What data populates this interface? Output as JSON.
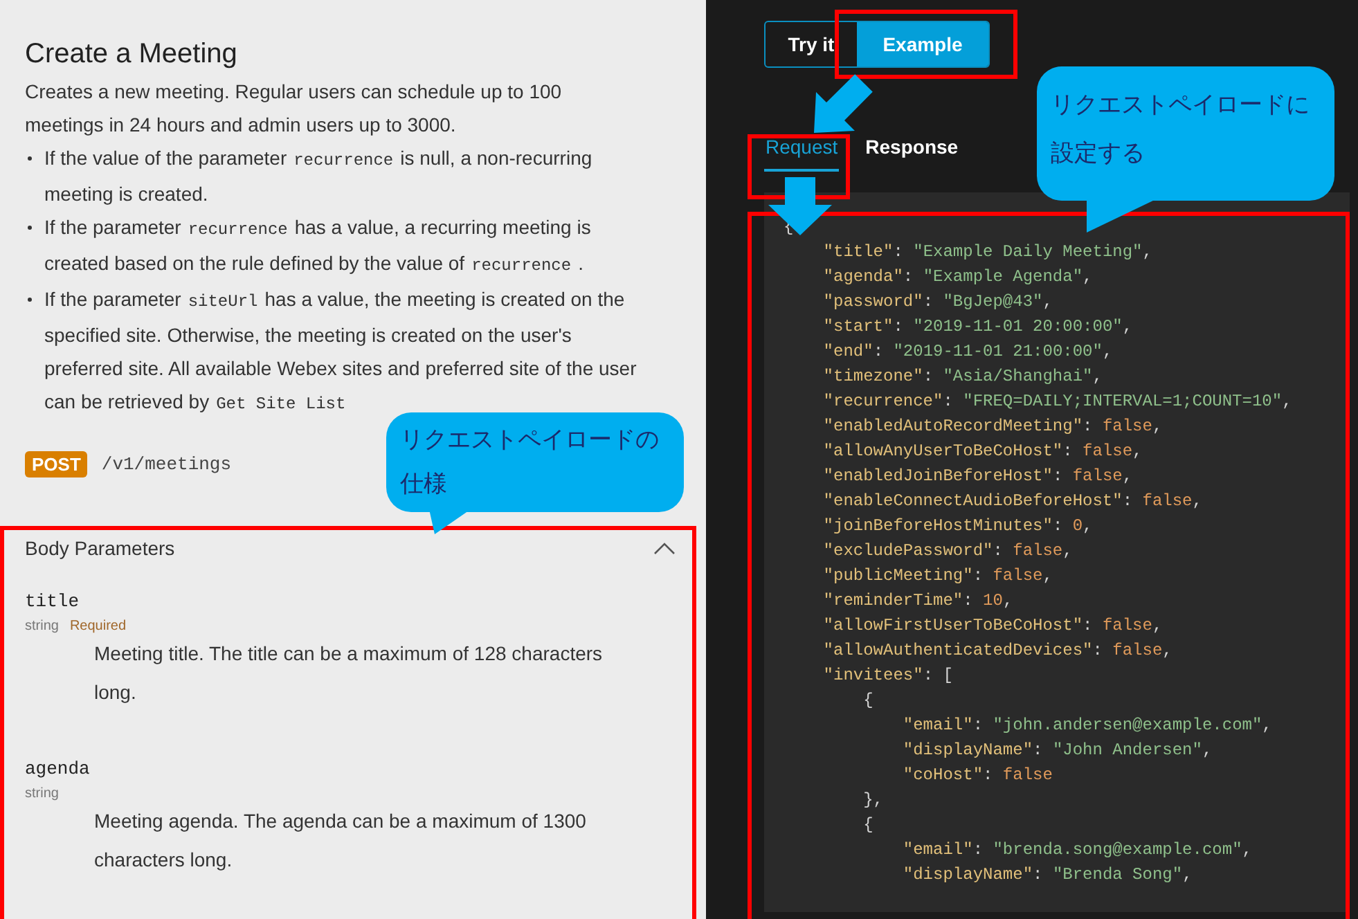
{
  "doc": {
    "title": "Create a Meeting",
    "description": "Creates a new meeting. Regular users can schedule up to 100 meetings in 24 hours and admin users up to 3000.",
    "bullets": [
      [
        {
          "kind": "text",
          "text": "If the value of the parameter"
        },
        {
          "kind": "code",
          "text": "recurrence"
        },
        {
          "kind": "text",
          "text": "is null, a non-recurring meeting is created."
        }
      ],
      [
        {
          "kind": "text",
          "text": "If the parameter"
        },
        {
          "kind": "code",
          "text": "recurrence"
        },
        {
          "kind": "text",
          "text": "has a value, a recurring meeting is created based on the rule defined by the value of"
        },
        {
          "kind": "code",
          "text": "recurrence"
        },
        {
          "kind": "text",
          "text": "."
        }
      ],
      [
        {
          "kind": "text",
          "text": "If the parameter"
        },
        {
          "kind": "code",
          "text": "siteUrl"
        },
        {
          "kind": "text",
          "text": "has a value, the meeting is created on the specified site. Otherwise, the meeting is created on the user's preferred site. All available Webex sites and preferred site of the user can be retrieved by"
        },
        {
          "kind": "code",
          "text": "Get Site List"
        }
      ]
    ],
    "endpoint": {
      "method": "POST",
      "path": "/v1/meetings"
    },
    "body_parameters": {
      "title": "Body Parameters",
      "expanded": true,
      "params": [
        {
          "name": "title",
          "type": "string",
          "required_label": "Required",
          "description": "Meeting title. The title can be a maximum of 128 characters long."
        },
        {
          "name": "agenda",
          "type": "string",
          "description": "Meeting agenda. The agenda can be a maximum of 1300 characters long."
        }
      ]
    }
  },
  "example": {
    "mode_buttons": [
      {
        "label": "Try it",
        "selected": false
      },
      {
        "label": "Example",
        "selected": true
      }
    ],
    "tabs": [
      {
        "label": "Request",
        "selected": true
      },
      {
        "label": "Response",
        "selected": false
      }
    ],
    "code_lines": [
      {
        "tokens": [
          {
            "kind": "punct",
            "text": "{"
          }
        ],
        "children": [
          {
            "tokens": [
              {
                "kind": "key",
                "text": "\"title\""
              },
              {
                "kind": "punct",
                "text": ": "
              },
              {
                "kind": "string",
                "text": "\"Example Daily Meeting\""
              },
              {
                "kind": "punct",
                "text": ","
              }
            ]
          },
          {
            "tokens": [
              {
                "kind": "key",
                "text": "\"agenda\""
              },
              {
                "kind": "punct",
                "text": ": "
              },
              {
                "kind": "string",
                "text": "\"Example Agenda\""
              },
              {
                "kind": "punct",
                "text": ","
              }
            ]
          },
          {
            "tokens": [
              {
                "kind": "key",
                "text": "\"password\""
              },
              {
                "kind": "punct",
                "text": ": "
              },
              {
                "kind": "string",
                "text": "\"BgJep@43\""
              },
              {
                "kind": "punct",
                "text": ","
              }
            ]
          },
          {
            "tokens": [
              {
                "kind": "key",
                "text": "\"start\""
              },
              {
                "kind": "punct",
                "text": ": "
              },
              {
                "kind": "string",
                "text": "\"2019-11-01 20:00:00\""
              },
              {
                "kind": "punct",
                "text": ","
              }
            ]
          },
          {
            "tokens": [
              {
                "kind": "key",
                "text": "\"end\""
              },
              {
                "kind": "punct",
                "text": ": "
              },
              {
                "kind": "string",
                "text": "\"2019-11-01 21:00:00\""
              },
              {
                "kind": "punct",
                "text": ","
              }
            ]
          },
          {
            "tokens": [
              {
                "kind": "key",
                "text": "\"timezone\""
              },
              {
                "kind": "punct",
                "text": ": "
              },
              {
                "kind": "string",
                "text": "\"Asia/Shanghai\""
              },
              {
                "kind": "punct",
                "text": ","
              }
            ]
          },
          {
            "tokens": [
              {
                "kind": "key",
                "text": "\"recurrence\""
              },
              {
                "kind": "punct",
                "text": ": "
              },
              {
                "kind": "string",
                "text": "\"FREQ=DAILY;INTERVAL=1;COUNT=10\""
              },
              {
                "kind": "punct",
                "text": ","
              }
            ]
          },
          {
            "tokens": [
              {
                "kind": "key",
                "text": "\"enabledAutoRecordMeeting\""
              },
              {
                "kind": "punct",
                "text": ": "
              },
              {
                "kind": "literal",
                "text": "false"
              },
              {
                "kind": "punct",
                "text": ","
              }
            ]
          },
          {
            "tokens": [
              {
                "kind": "key",
                "text": "\"allowAnyUserToBeCoHost\""
              },
              {
                "kind": "punct",
                "text": ": "
              },
              {
                "kind": "literal",
                "text": "false"
              },
              {
                "kind": "punct",
                "text": ","
              }
            ]
          },
          {
            "tokens": [
              {
                "kind": "key",
                "text": "\"enabledJoinBeforeHost\""
              },
              {
                "kind": "punct",
                "text": ": "
              },
              {
                "kind": "literal",
                "text": "false"
              },
              {
                "kind": "punct",
                "text": ","
              }
            ]
          },
          {
            "tokens": [
              {
                "kind": "key",
                "text": "\"enableConnectAudioBeforeHost\""
              },
              {
                "kind": "punct",
                "text": ": "
              },
              {
                "kind": "literal",
                "text": "false"
              },
              {
                "kind": "punct",
                "text": ","
              }
            ]
          },
          {
            "tokens": [
              {
                "kind": "key",
                "text": "\"joinBeforeHostMinutes\""
              },
              {
                "kind": "punct",
                "text": ": "
              },
              {
                "kind": "literal",
                "text": "0"
              },
              {
                "kind": "punct",
                "text": ","
              }
            ]
          },
          {
            "tokens": [
              {
                "kind": "key",
                "text": "\"excludePassword\""
              },
              {
                "kind": "punct",
                "text": ": "
              },
              {
                "kind": "literal",
                "text": "false"
              },
              {
                "kind": "punct",
                "text": ","
              }
            ]
          },
          {
            "tokens": [
              {
                "kind": "key",
                "text": "\"publicMeeting\""
              },
              {
                "kind": "punct",
                "text": ": "
              },
              {
                "kind": "literal",
                "text": "false"
              },
              {
                "kind": "punct",
                "text": ","
              }
            ]
          },
          {
            "tokens": [
              {
                "kind": "key",
                "text": "\"reminderTime\""
              },
              {
                "kind": "punct",
                "text": ": "
              },
              {
                "kind": "literal",
                "text": "10"
              },
              {
                "kind": "punct",
                "text": ","
              }
            ]
          },
          {
            "tokens": [
              {
                "kind": "key",
                "text": "\"allowFirstUserToBeCoHost\""
              },
              {
                "kind": "punct",
                "text": ": "
              },
              {
                "kind": "literal",
                "text": "false"
              },
              {
                "kind": "punct",
                "text": ","
              }
            ]
          },
          {
            "tokens": [
              {
                "kind": "key",
                "text": "\"allowAuthenticatedDevices\""
              },
              {
                "kind": "punct",
                "text": ": "
              },
              {
                "kind": "literal",
                "text": "false"
              },
              {
                "kind": "punct",
                "text": ","
              }
            ]
          },
          {
            "tokens": [
              {
                "kind": "key",
                "text": "\"invitees\""
              },
              {
                "kind": "punct",
                "text": ": ["
              }
            ],
            "children": [
              {
                "tokens": [
                  {
                    "kind": "punct",
                    "text": "{"
                  }
                ],
                "children": [
                  {
                    "tokens": [
                      {
                        "kind": "key",
                        "text": "\"email\""
                      },
                      {
                        "kind": "punct",
                        "text": ": "
                      },
                      {
                        "kind": "string",
                        "text": "\"john.andersen@example.com\""
                      },
                      {
                        "kind": "punct",
                        "text": ","
                      }
                    ]
                  },
                  {
                    "tokens": [
                      {
                        "kind": "key",
                        "text": "\"displayName\""
                      },
                      {
                        "kind": "punct",
                        "text": ": "
                      },
                      {
                        "kind": "string",
                        "text": "\"John Andersen\""
                      },
                      {
                        "kind": "punct",
                        "text": ","
                      }
                    ]
                  },
                  {
                    "tokens": [
                      {
                        "kind": "key",
                        "text": "\"coHost\""
                      },
                      {
                        "kind": "punct",
                        "text": ": "
                      },
                      {
                        "kind": "literal",
                        "text": "false"
                      }
                    ]
                  }
                ]
              },
              {
                "tokens": [
                  {
                    "kind": "punct",
                    "text": "},"
                  }
                ]
              },
              {
                "tokens": [
                  {
                    "kind": "punct",
                    "text": "{"
                  }
                ],
                "children": [
                  {
                    "tokens": [
                      {
                        "kind": "key",
                        "text": "\"email\""
                      },
                      {
                        "kind": "punct",
                        "text": ": "
                      },
                      {
                        "kind": "string",
                        "text": "\"brenda.song@example.com\""
                      },
                      {
                        "kind": "punct",
                        "text": ","
                      }
                    ]
                  },
                  {
                    "tokens": [
                      {
                        "kind": "key",
                        "text": "\"displayName\""
                      },
                      {
                        "kind": "punct",
                        "text": ": "
                      },
                      {
                        "kind": "string",
                        "text": "\"Brenda Song\""
                      },
                      {
                        "kind": "punct",
                        "text": ","
                      }
                    ]
                  }
                ]
              }
            ]
          }
        ]
      }
    ]
  },
  "annotations": {
    "callouts": [
      {
        "text": "リクエストペイロードの仕様"
      },
      {
        "text": "リクエストペイロードに設定する"
      }
    ]
  }
}
